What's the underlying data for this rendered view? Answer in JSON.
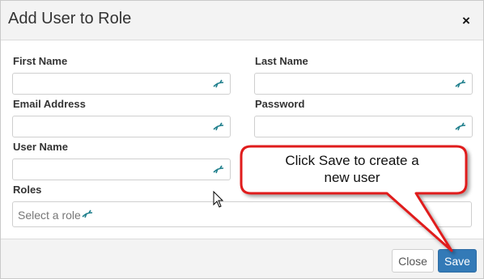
{
  "dialog": {
    "title": "Add User to Role",
    "close_icon": "×"
  },
  "form": {
    "first_name": {
      "label": "First Name",
      "value": "",
      "placeholder": ""
    },
    "last_name": {
      "label": "Last Name",
      "value": "",
      "placeholder": ""
    },
    "email": {
      "label": "Email Address",
      "value": "",
      "placeholder": ""
    },
    "password": {
      "label": "Password",
      "value": "",
      "placeholder": ""
    },
    "user_name": {
      "label": "User Name",
      "value": "",
      "placeholder": ""
    },
    "roles": {
      "label": "Roles",
      "placeholder": "Select a role"
    }
  },
  "footer": {
    "close_label": "Close",
    "save_label": "Save"
  },
  "callout": {
    "line1": "Click Save to create a",
    "line2": "new user",
    "border_color": "#e01b1b"
  },
  "icons": {
    "field_icon": "lastpass-autofill-icon",
    "cursor": "mouse-pointer-icon"
  },
  "colors": {
    "accent": "#337ab7",
    "header_bg": "#f3f3f3",
    "icon_teal": "#1f7f8c"
  }
}
